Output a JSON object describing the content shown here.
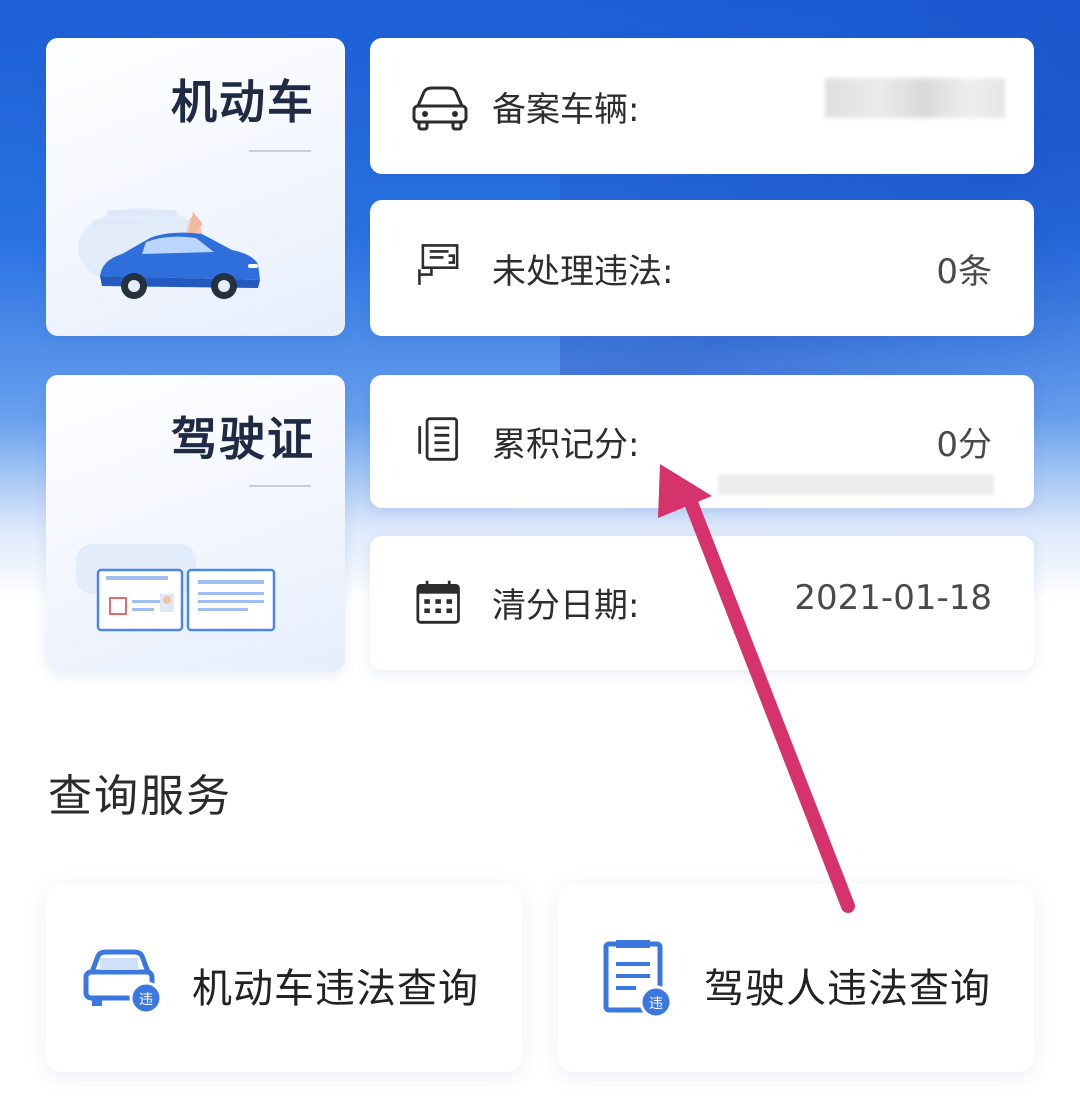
{
  "vehicle_card": {
    "title": "机动车"
  },
  "license_card": {
    "title": "驾驶证"
  },
  "info_rows": [
    {
      "label": "备案车辆:",
      "value": "",
      "icon": "car-outline-icon"
    },
    {
      "label": "未处理违法:",
      "value": "0条",
      "icon": "camera-icon"
    },
    {
      "label": "累积记分:",
      "value": "0分",
      "icon": "document-list-icon"
    },
    {
      "label": "清分日期:",
      "value": "2021-01-18",
      "icon": "calendar-icon"
    }
  ],
  "section": {
    "title": "查询服务"
  },
  "services": [
    {
      "label": "机动车违法查询",
      "icon": "car-violation-icon"
    },
    {
      "label": "驾驶人违法查询",
      "icon": "driver-violation-icon"
    }
  ],
  "colors": {
    "brand_blue": "#2a72e2",
    "icon_blue": "#3a78e0",
    "arrow": "#d6336c"
  }
}
